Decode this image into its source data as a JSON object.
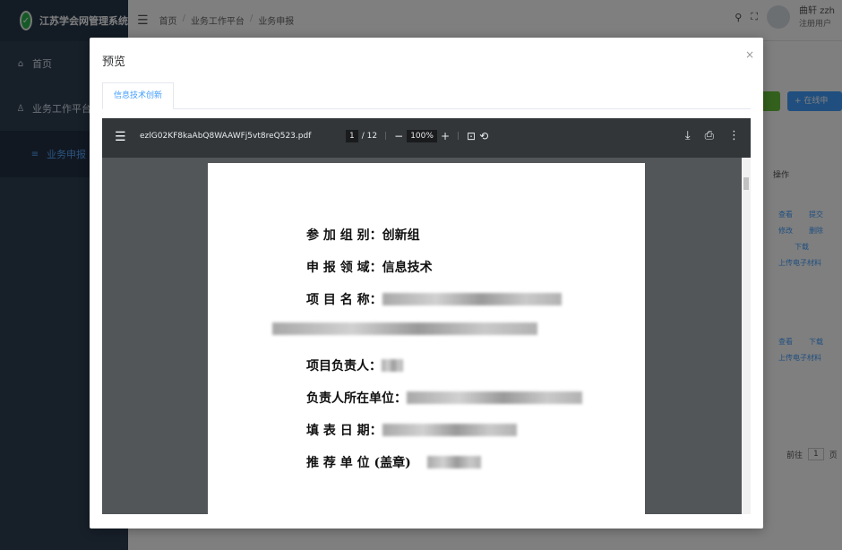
{
  "app": {
    "title": "江苏学会网管理系统",
    "logo_glyph": "✓"
  },
  "sidebar": {
    "items": [
      {
        "label": "首页",
        "icon": "home-icon"
      },
      {
        "label": "业务工作平台",
        "icon": "user-icon"
      },
      {
        "label": "业务申报",
        "icon": "list-icon"
      }
    ]
  },
  "header": {
    "collapse_icon": "☰",
    "breadcrumb": [
      "首页",
      "业务工作平台",
      "业务申报"
    ],
    "user_name": "曲轩 zzh",
    "user_role": "注册用户"
  },
  "background": {
    "add_button": "+ 在线申报",
    "column_header": "操作",
    "row1_links": [
      "查看",
      "提交",
      "修改",
      "删除",
      "下载",
      "上传电子材料"
    ],
    "row2_links": [
      "查看",
      "下载",
      "上传电子材料"
    ],
    "pager_label": "前往",
    "pager_page": "1",
    "pager_suffix": "页"
  },
  "dialog": {
    "title": "预览",
    "close": "×",
    "tab": "信息技术创新",
    "viewer": {
      "filename": "ezlG02KF8kaAbQ8WAAWFj5vt8reQ523.pdf",
      "current_page": "1",
      "total_pages": "/ 12",
      "zoom": "100%",
      "zoom_out": "−",
      "zoom_in": "+"
    },
    "document": {
      "group_label": "参 加 组 别：",
      "group_value": "创新组",
      "field_label": "申 报 领 域：",
      "field_value": "信息技术",
      "project_label": "项 目 名 称：",
      "leader_label": "项目负责人：",
      "unit_label": "负责人所在单位：",
      "date_label": "填 表 日 期：",
      "recommend_label": "推 荐 单 位 (盖章)"
    }
  }
}
